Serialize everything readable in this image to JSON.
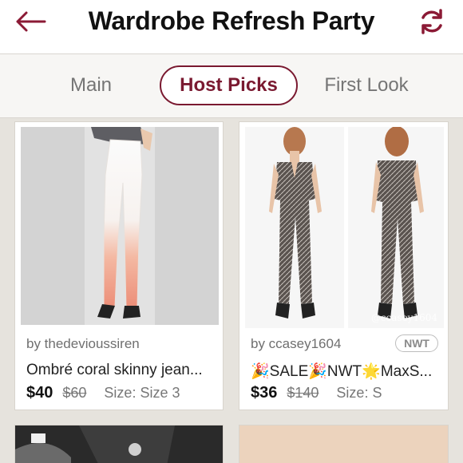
{
  "header": {
    "title": "Wardrobe Refresh Party",
    "back_icon": "back-arrow-icon",
    "refresh_icon": "refresh-icon",
    "accent_color": "#8b1a35"
  },
  "tabs": [
    {
      "label": "Main",
      "active": false
    },
    {
      "label": "Host Picks",
      "active": true
    },
    {
      "label": "First Look",
      "active": false
    }
  ],
  "listings": [
    {
      "seller": "by thedevioussiren",
      "title": "Ombré coral skinny jean...",
      "price": "$40",
      "original_price": "$60",
      "size": "Size: Size 3",
      "badge": ""
    },
    {
      "seller": "by ccasey1604",
      "title": "🎉SALE🎉NWT🌟MaxS...",
      "price": "$36",
      "original_price": "$140",
      "size": "Size: S",
      "badge": "NWT",
      "photo_watermark": "@ccasey1604"
    }
  ]
}
